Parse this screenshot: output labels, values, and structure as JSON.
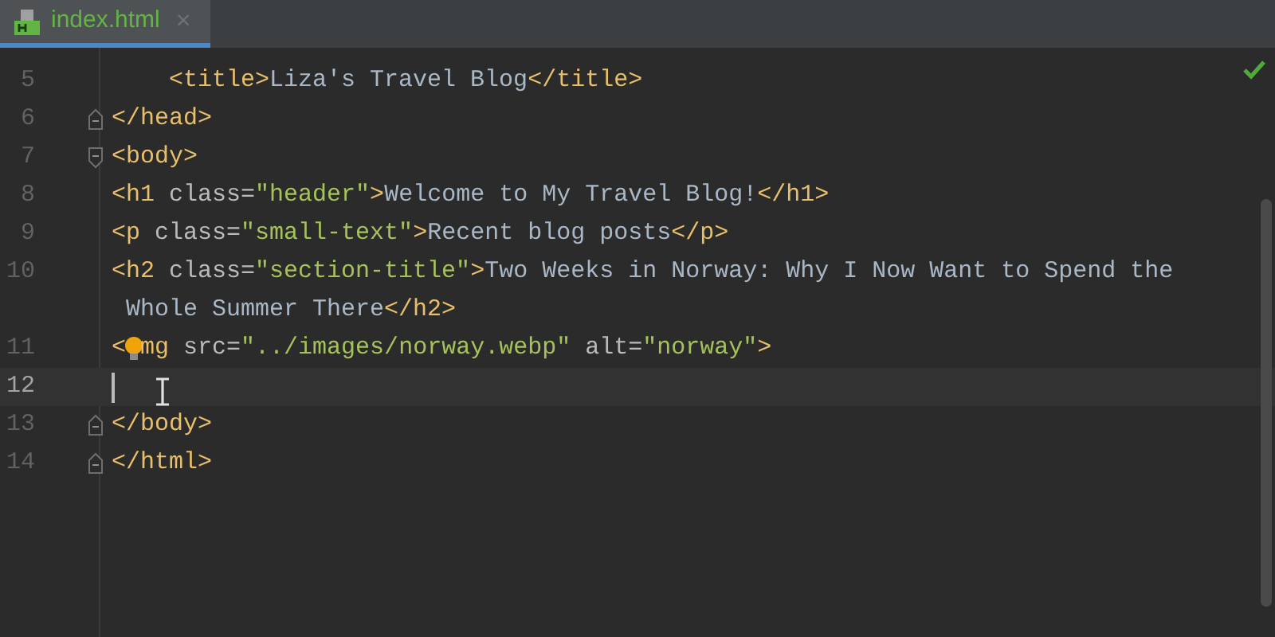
{
  "tabs": [
    {
      "label": "index.html",
      "selected": true,
      "close": "×"
    }
  ],
  "inspection": {
    "ok": true
  },
  "lines": [
    {
      "number": "5",
      "current": false,
      "caret": false,
      "rows": [
        [
          {
            "kind": "indent",
            "text": "    "
          },
          {
            "kind": "tag",
            "text": "<title>"
          },
          {
            "kind": "text",
            "text": "Liza's Travel Blog"
          },
          {
            "kind": "tag",
            "text": "</title>"
          }
        ]
      ]
    },
    {
      "number": "6",
      "current": false,
      "caret": false,
      "kind": "fold-end",
      "rows": [
        [
          {
            "kind": "tag",
            "text": "</head>"
          }
        ]
      ]
    },
    {
      "number": "7",
      "current": false,
      "caret": false,
      "kind": "fold-start",
      "rows": [
        [
          {
            "kind": "tag",
            "text": "<body>"
          }
        ]
      ]
    },
    {
      "number": "8",
      "current": false,
      "caret": false,
      "rows": [
        [
          {
            "kind": "tag",
            "text": "<h1 "
          },
          {
            "kind": "attr",
            "text": "class="
          },
          {
            "kind": "string",
            "text": "\"header\""
          },
          {
            "kind": "tag",
            "text": ">"
          },
          {
            "kind": "text",
            "text": "Welcome to My Travel Blog!"
          },
          {
            "kind": "tag",
            "text": "</h1>"
          }
        ]
      ]
    },
    {
      "number": "9",
      "current": false,
      "caret": false,
      "rows": [
        [
          {
            "kind": "tag",
            "text": "<p "
          },
          {
            "kind": "attr",
            "text": "class="
          },
          {
            "kind": "string",
            "text": "\"small-text\""
          },
          {
            "kind": "tag",
            "text": ">"
          },
          {
            "kind": "text",
            "text": "Recent blog posts"
          },
          {
            "kind": "tag",
            "text": "</p>"
          }
        ]
      ]
    },
    {
      "number": "10",
      "current": false,
      "caret": false,
      "rows": [
        [
          {
            "kind": "tag",
            "text": "<h2 "
          },
          {
            "kind": "attr",
            "text": "class="
          },
          {
            "kind": "string",
            "text": "\"section-title\""
          },
          {
            "kind": "tag",
            "text": ">"
          },
          {
            "kind": "text",
            "text": "Two Weeks in Norway: Why I Now Want to Spend the"
          }
        ],
        [
          {
            "kind": "indent",
            "text": " "
          },
          {
            "kind": "text",
            "text": "Whole Summer There"
          },
          {
            "kind": "tag",
            "text": "</h2>"
          }
        ]
      ]
    },
    {
      "number": "11",
      "current": false,
      "caret": false,
      "rows": [
        [
          {
            "kind": "tag",
            "text": "<"
          },
          {
            "kind": "bulb"
          },
          {
            "kind": "tag",
            "text": "mg "
          },
          {
            "kind": "attr",
            "text": "src="
          },
          {
            "kind": "string",
            "text": "\"../images/norway.webp\""
          },
          {
            "kind": "attr",
            "text": " alt="
          },
          {
            "kind": "string",
            "text": "\"norway\""
          },
          {
            "kind": "tag",
            "text": ">"
          }
        ]
      ]
    },
    {
      "number": "12",
      "current": true,
      "caret": true,
      "rows": [
        []
      ]
    },
    {
      "number": "13",
      "current": false,
      "caret": false,
      "kind": "fold-end",
      "rows": [
        [
          {
            "kind": "tag",
            "text": "</body>"
          }
        ]
      ]
    },
    {
      "number": "14",
      "current": false,
      "caret": false,
      "kind": "fold-end",
      "rows": [
        [
          {
            "kind": "tag",
            "text": "</html>"
          }
        ]
      ]
    }
  ]
}
